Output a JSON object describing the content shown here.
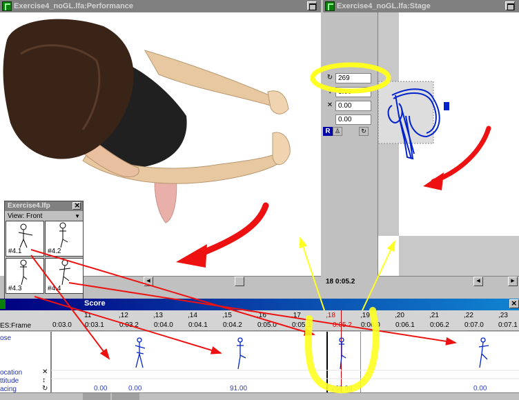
{
  "performance": {
    "title": "Exercise4_noGL.lfa:Performance"
  },
  "stage": {
    "title": "Exercise4_noGL.lfa:Stage",
    "fields": [
      "269",
      "0.00",
      "0.00",
      "0.00"
    ],
    "rotate_label": "R",
    "status": "18  0:05.2"
  },
  "library": {
    "title": "Exercise4.lfp",
    "view_label": "View: Front",
    "items": [
      "#4.1",
      "#4.2",
      "#4.3",
      "#4.4"
    ]
  },
  "score": {
    "title": "Score",
    "header_label": "ES:Frame",
    "frames": [
      "11",
      ",12",
      ",13",
      ",14",
      ",15",
      ",16",
      ",17",
      ",18",
      ",19",
      ",20",
      ",21",
      ",22",
      ",23"
    ],
    "times": [
      "0:03.0",
      "0:03.1",
      "0:03.2",
      "0:04.0",
      "0:04.1",
      "0:04.2",
      "0:05.0",
      "0:05.1",
      "0:05.2",
      "0:06.0",
      "0:06.1",
      "0:06.2",
      "0:07.0",
      "0:07.1"
    ],
    "current_time": "0:05.2",
    "track_labels": [
      "ose",
      "ocation",
      "ttitude",
      "acing"
    ],
    "values": [
      "0.00",
      "0.00",
      "91.00",
      "268.99",
      "0.00"
    ]
  },
  "colors": {
    "accent": "#0000aa",
    "arrow_red": "#ee1111",
    "arrow_yellow": "#ffff22",
    "figure_blue": "#0022cc"
  }
}
